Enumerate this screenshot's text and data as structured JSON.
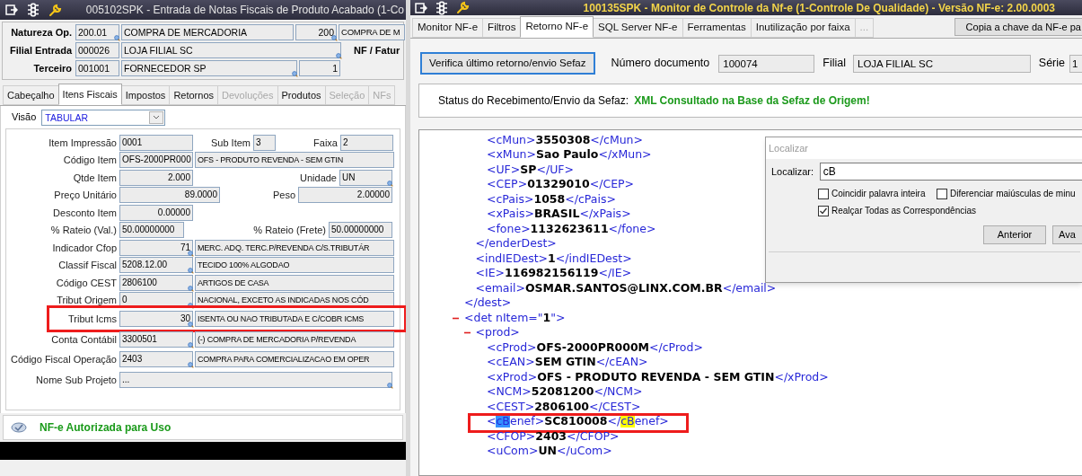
{
  "left_window": {
    "title": "005102SPK - Entrada de Notas Fiscais de Produto Acabado (1-Co",
    "header": [
      {
        "label": "Natureza Op.",
        "fields": [
          {
            "value": "200.01",
            "lookup": true
          },
          {
            "value": "COMPRA DE MERCADORIA",
            "lookup": false
          },
          {
            "value": "200",
            "lookup": true
          },
          {
            "value": "COMPRA DE M",
            "lookup": false
          }
        ]
      },
      {
        "label": "Filial Entrada",
        "fields": [
          {
            "value": "000026",
            "lookup": false
          },
          {
            "value": "LOJA FILIAL SC",
            "lookup": true
          }
        ],
        "side_label": "NF / Fatur"
      },
      {
        "label": "Terceiro",
        "fields": [
          {
            "value": "001001",
            "lookup": false
          },
          {
            "value": "FORNECEDOR SP",
            "lookup": true
          },
          {
            "value": "1",
            "lookup": false
          }
        ]
      }
    ],
    "tabs": [
      {
        "label": "Cabeçalho",
        "selected": false,
        "disabled": false
      },
      {
        "label": "Itens Fiscais",
        "selected": true,
        "disabled": false
      },
      {
        "label": "Impostos",
        "selected": false,
        "disabled": false
      },
      {
        "label": "Retornos",
        "selected": false,
        "disabled": false
      },
      {
        "label": "Devoluções",
        "selected": false,
        "disabled": true
      },
      {
        "label": "Produtos",
        "selected": false,
        "disabled": false
      },
      {
        "label": "Seleção",
        "selected": false,
        "disabled": true
      },
      {
        "label": "NFs",
        "selected": false,
        "disabled": true
      }
    ],
    "view": {
      "label": "Visão",
      "value": "TABULAR"
    },
    "rows": [
      {
        "kind": "item_print",
        "annotated": false,
        "fields": [
          {
            "label": "Item Impressão",
            "value": "0001",
            "lookup": false
          },
          {
            "label": "Sub Item",
            "value": "3",
            "lookup": false
          },
          {
            "label": "Faixa",
            "value": "2",
            "lookup": false
          }
        ]
      },
      {
        "kind": "code_desc",
        "annotated": false,
        "fields": [
          {
            "label": "Código Item",
            "value": "OFS-2000PR000",
            "lookup": false
          },
          {
            "value": "OFS - PRODUTO REVENDA - SEM GTIN",
            "lookup": false
          }
        ]
      },
      {
        "kind": "qty_unit",
        "annotated": false,
        "fields": [
          {
            "label": "Qtde Item",
            "value": "2.000",
            "lookup": false
          },
          {
            "label": "Unidade",
            "value": "UN",
            "lookup": true
          }
        ]
      },
      {
        "kind": "price_weight",
        "annotated": false,
        "fields": [
          {
            "label": "Preço Unitário",
            "value": "89.0000",
            "lookup": false
          },
          {
            "label": "Peso",
            "value": "2.00000",
            "lookup": false
          }
        ]
      },
      {
        "kind": "single",
        "annotated": false,
        "fields": [
          {
            "label": "Desconto Item",
            "value": "0.00000",
            "lookup": false
          }
        ]
      },
      {
        "kind": "rateio",
        "annotated": false,
        "fields": [
          {
            "label": "% Rateio (Val.)",
            "value": "50.00000000",
            "lookup": false
          },
          {
            "label": "% Rateio (Frete)",
            "value": "50.00000000",
            "lookup": false
          }
        ]
      },
      {
        "kind": "code_desc",
        "annotated": false,
        "fields": [
          {
            "label": "Indicador Cfop",
            "value": "71",
            "lookup": true
          },
          {
            "value": "MERC. ADQ. TERC.P/REVENDA C/S.TRIBUTÁR",
            "lookup": false
          }
        ]
      },
      {
        "kind": "code_desc",
        "annotated": false,
        "fields": [
          {
            "label": "Classif Fiscal",
            "value": "5208.12.00",
            "lookup": true
          },
          {
            "value": "TECIDO 100% ALGODAO",
            "lookup": false
          }
        ]
      },
      {
        "kind": "code_desc",
        "annotated": false,
        "fields": [
          {
            "label": "Código CEST",
            "value": "2806100",
            "lookup": true
          },
          {
            "value": "ARTIGOS DE CASA",
            "lookup": false
          }
        ]
      },
      {
        "kind": "code_desc",
        "annotated": false,
        "fields": [
          {
            "label": "Tribut Origem",
            "value": "0",
            "lookup": true
          },
          {
            "value": "NACIONAL, EXCETO AS INDICADAS NOS CÓD",
            "lookup": false
          }
        ]
      },
      {
        "kind": "code_desc",
        "annotated": true,
        "fields": [
          {
            "label": "Tribut Icms",
            "value": "30",
            "lookup": true
          },
          {
            "value": "ISENTA OU NAO TRIBUTADA E C/COBR ICMS",
            "lookup": false
          }
        ]
      },
      {
        "kind": "code_desc",
        "annotated": false,
        "fields": [
          {
            "label": "Conta Contábil",
            "value": "3300501",
            "lookup": true
          },
          {
            "value": "(-) COMPRA DE MERCADORIA P/REVENDA",
            "lookup": false
          }
        ]
      },
      {
        "kind": "code_desc",
        "annotated": false,
        "fields": [
          {
            "label": "Código Fiscal Operação",
            "value": "2403",
            "lookup": true
          },
          {
            "value": "COMPRA PARA COMERCIALIZACAO EM OPER",
            "lookup": false
          }
        ]
      },
      {
        "kind": "wide",
        "annotated": false,
        "fields": [
          {
            "label": "Nome Sub Projeto",
            "value": "...",
            "lookup": true
          }
        ]
      }
    ],
    "status": "NF-e Autorizada para Uso"
  },
  "right_window": {
    "title": "100135SPK - Monitor de Controle da Nf-e (1-Controle De Qualidade) - Versão NF-e: 2.00.0003",
    "tabs": [
      {
        "label": "Monitor NF-e",
        "selected": false,
        "disabled": false
      },
      {
        "label": "Filtros",
        "selected": false,
        "disabled": false
      },
      {
        "label": "Retorno NF-e",
        "selected": true,
        "disabled": false
      },
      {
        "label": "SQL Server NF-e",
        "selected": false,
        "disabled": false
      },
      {
        "label": "Ferramentas",
        "selected": false,
        "disabled": false
      },
      {
        "label": "Inutilização por faixa",
        "selected": false,
        "disabled": false
      },
      {
        "label": "...",
        "selected": false,
        "disabled": true
      }
    ],
    "copy_button": "Copia a chave da NF-e pa",
    "verify_button": "Verifica último retorno/envio Sefaz",
    "document": {
      "label": "Número documento",
      "value": "100074"
    },
    "branch": {
      "label": "Filial",
      "value": "LOJA FILIAL SC"
    },
    "series": {
      "label": "Série",
      "value": "1"
    },
    "sefaz_status": {
      "label": "Status do Recebimento/Envio da Sefaz:",
      "value": "XML Consultado na Base da Sefaz de Origem!"
    },
    "xml": [
      {
        "kind": "continued",
        "children": [
          {
            "kind": "continued",
            "children": [
              {
                "kind": "line",
                "open": "<cMun>",
                "value": "3550308",
                "close": "</cMun>",
                "annotated": false
              },
              {
                "kind": "line",
                "open": "<xMun>",
                "value": "Sao Paulo",
                "close": "</xMun>",
                "annotated": false
              },
              {
                "kind": "line",
                "open": "<UF>",
                "value": "SP",
                "close": "</UF>",
                "annotated": false
              },
              {
                "kind": "line",
                "open": "<CEP>",
                "value": "01329010",
                "close": "</CEP>",
                "annotated": false
              },
              {
                "kind": "line",
                "open": "<cPais>",
                "value": "1058",
                "close": "</cPais>",
                "annotated": false
              },
              {
                "kind": "line",
                "open": "<xPais>",
                "value": "BRASIL",
                "close": "</xPais>",
                "annotated": false
              },
              {
                "kind": "line",
                "open": "<fone>",
                "value": "1132623611",
                "close": "</fone>",
                "annotated": false
              }
            ]
          },
          {
            "kind": "line",
            "open": "</enderDest>",
            "annotated": false
          },
          {
            "kind": "line",
            "open": "<indIEDest>",
            "value": "1",
            "close": "</indIEDest>",
            "annotated": false
          },
          {
            "kind": "line",
            "open": "<IE>",
            "value": "116982156119",
            "close": "</IE>",
            "annotated": false
          },
          {
            "kind": "line",
            "open": "<email>",
            "value": "OSMAR.SANTOS@LINX.COM.BR",
            "close": "</email>",
            "annotated": false
          }
        ]
      },
      {
        "kind": "line",
        "open": "</dest>",
        "annotated": false
      },
      {
        "kind": "line",
        "open": "<det nItem=\"",
        "value": "1",
        "close": "\">",
        "annotated": false,
        "expanded": true,
        "children": [
          {
            "kind": "line",
            "open": "<prod>",
            "annotated": false,
            "expanded": true,
            "children": [
              {
                "kind": "line",
                "open": "<cProd>",
                "value": "OFS-2000PR000M",
                "close": "</cProd>",
                "annotated": false
              },
              {
                "kind": "line",
                "open": "<cEAN>",
                "value": "SEM GTIN",
                "close": "</cEAN>",
                "annotated": false
              },
              {
                "kind": "line",
                "open": "<xProd>",
                "value": "OFS - PRODUTO REVENDA - SEM GTIN",
                "close": "</xProd>",
                "annotated": false
              },
              {
                "kind": "line",
                "open": "<NCM>",
                "value": "52081200",
                "close": "</NCM>",
                "annotated": false
              },
              {
                "kind": "line",
                "open": "<CEST>",
                "value": "2806100",
                "close": "</CEST>",
                "annotated": false
              },
              {
                "kind": "line",
                "open_prefix": "<",
                "open_match": "cB",
                "open_suffix": "enef>",
                "value": "SC810008",
                "close_prefix": "</",
                "close_match": "cB",
                "close_suffix": "enef>",
                "annotated": true,
                "open_match_selected": true,
                "close_match_highlighted": true
              },
              {
                "kind": "line",
                "open": "<CFOP>",
                "value": "2403",
                "close": "</CFOP>",
                "annotated": false
              },
              {
                "kind": "line",
                "open": "<uCom>",
                "value": "UN",
                "close": "</uCom>",
                "annotated": false
              }
            ]
          }
        ]
      }
    ],
    "find_dialog": {
      "title": "Localizar",
      "label": "Localizar:",
      "value": "cB",
      "options": [
        {
          "label": "Coincidir palavra inteira",
          "checked": false
        },
        {
          "label": "Diferenciar maiúsculas de minu",
          "checked": false
        },
        {
          "label": "Realçar Todas as Correspondências",
          "checked": true
        }
      ],
      "buttons": [
        "Anterior",
        "Ava"
      ]
    }
  }
}
